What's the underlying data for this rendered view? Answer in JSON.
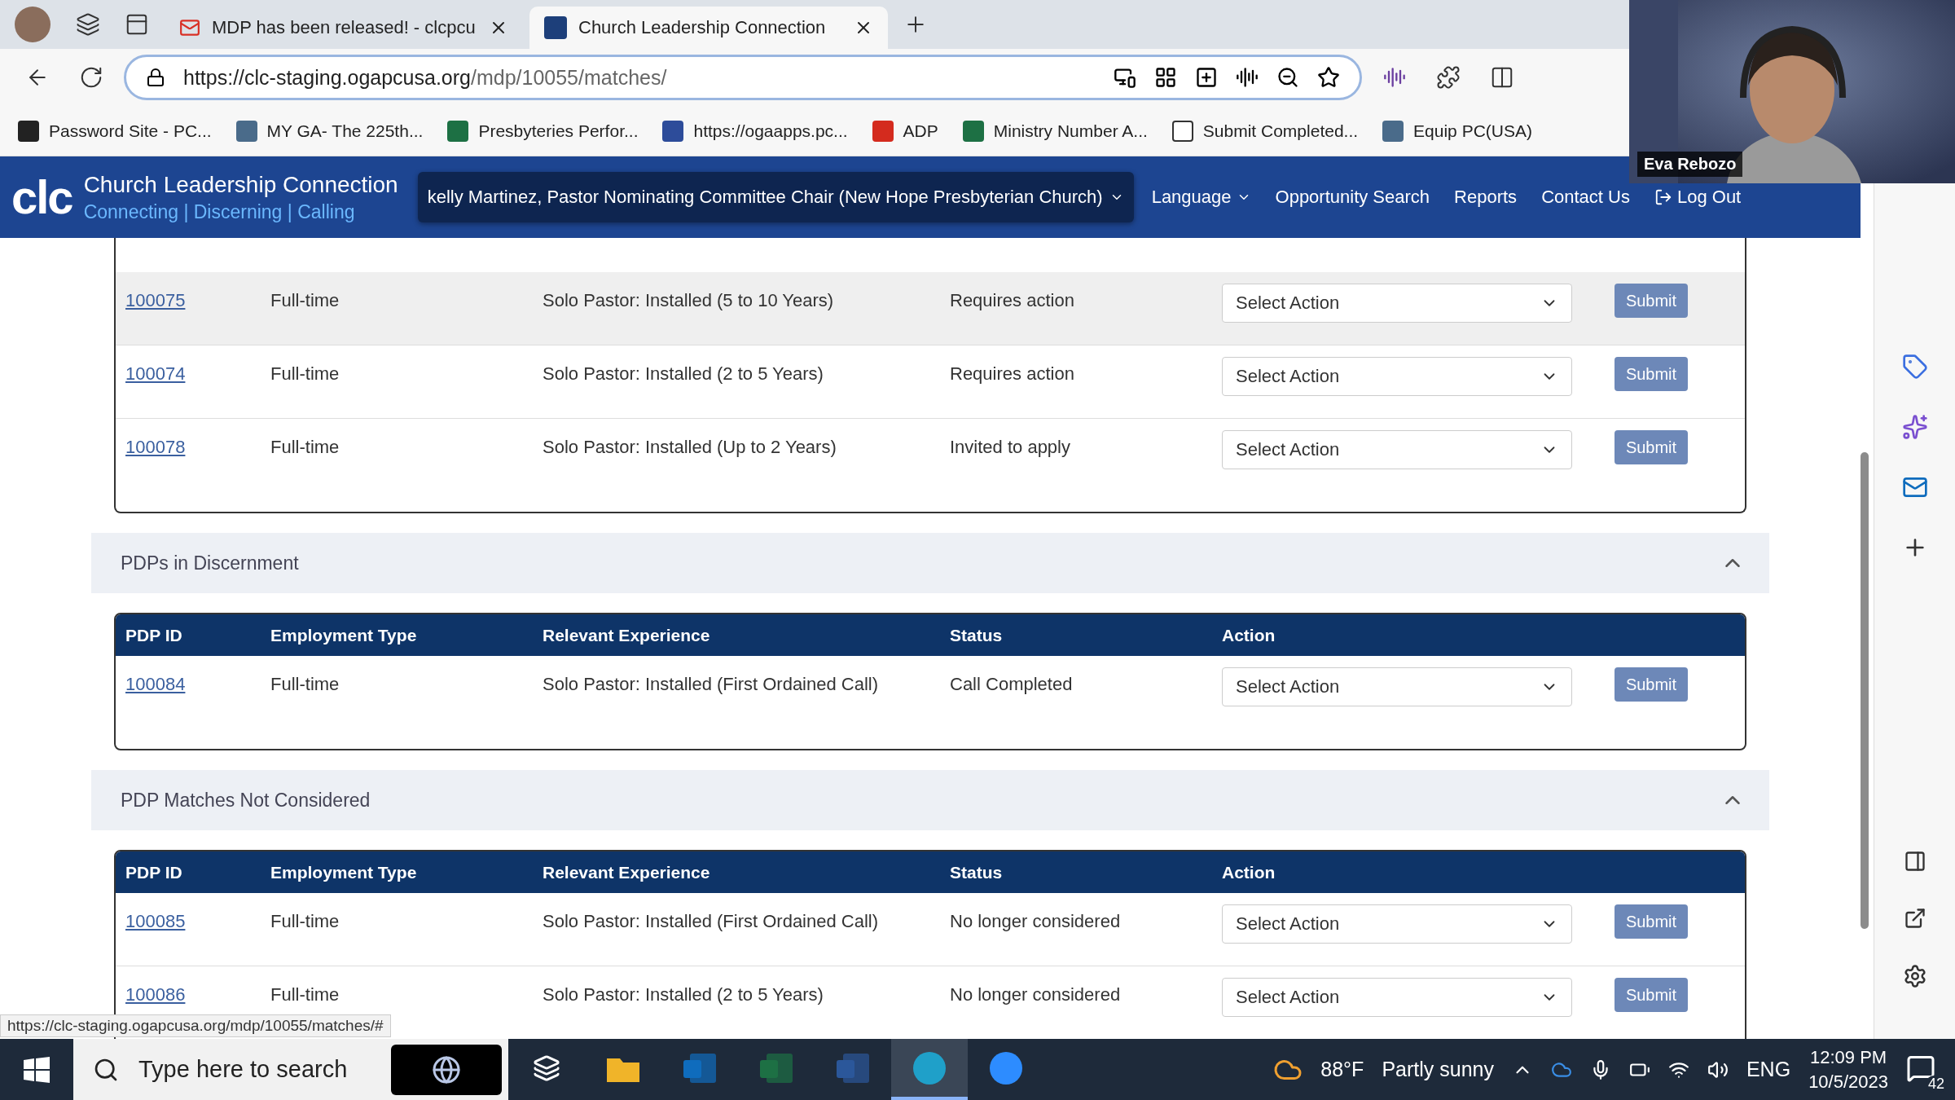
{
  "browser": {
    "tabs": [
      {
        "kind": "mail",
        "title": "MDP has been released! - clcpcu",
        "selected": false
      },
      {
        "kind": "site",
        "title": "Church Leadership Connection",
        "selected": true
      }
    ],
    "url_host": "https://clc-staging.ogapcusa.org",
    "url_path": "/mdp/10055/matches/",
    "bookmarks": [
      {
        "kind": "key",
        "label": "Password Site - PC..."
      },
      {
        "kind": "globe",
        "label": "MY GA- The 225th..."
      },
      {
        "kind": "sheet",
        "label": "Presbyteries Perfor..."
      },
      {
        "kind": "cross",
        "label": "https://ogaapps.pc..."
      },
      {
        "kind": "red",
        "label": "ADP"
      },
      {
        "kind": "sheet",
        "label": "Ministry Number A..."
      },
      {
        "kind": "page",
        "label": "Submit Completed..."
      },
      {
        "kind": "globe",
        "label": "Equip PC(USA)"
      }
    ]
  },
  "navbar": {
    "logo": "clc",
    "brand": "Church Leadership Connection",
    "tagline": "Connecting | Discerning | Calling",
    "user_menu": "kelly Martinez, Pastor Nominating Committee Chair (New Hope Presbyterian Church)",
    "links": [
      {
        "label": "Language",
        "kind": "dropdown"
      },
      {
        "label": "Opportunity Search",
        "kind": "link"
      },
      {
        "label": "Reports",
        "kind": "link"
      },
      {
        "label": "Contact Us",
        "kind": "link"
      },
      {
        "label": "Log Out",
        "kind": "logout"
      }
    ]
  },
  "sections": [
    {
      "rows": [
        {
          "id": "100075",
          "employment": "Full-time",
          "experience": "Solo Pastor: Installed (5 to 10 Years)",
          "status": "Requires action",
          "action": "Select Action",
          "button": "Submit",
          "highlighted": true
        },
        {
          "id": "100074",
          "employment": "Full-time",
          "experience": "Solo Pastor: Installed (2 to 5 Years)",
          "status": "Requires action",
          "action": "Select Action",
          "button": "Submit",
          "highlighted": false
        },
        {
          "id": "100078",
          "employment": "Full-time",
          "experience": "Solo Pastor: Installed (Up to 2 Years)",
          "status": "Invited to apply",
          "action": "Select Action",
          "button": "Submit",
          "highlighted": false
        }
      ]
    },
    {
      "title": "PDPs in Discernment",
      "expanded": true,
      "columns": [
        "PDP ID",
        "Employment Type",
        "Relevant Experience",
        "Status",
        "Action"
      ],
      "rows": [
        {
          "id": "100084",
          "employment": "Full-time",
          "experience": "Solo Pastor: Installed (First Ordained Call)",
          "status": "Call Completed",
          "action": "Select Action",
          "button": "Submit",
          "highlighted": false
        }
      ]
    },
    {
      "title": "PDP Matches Not Considered",
      "expanded": true,
      "columns": [
        "PDP ID",
        "Employment Type",
        "Relevant Experience",
        "Status",
        "Action"
      ],
      "rows": [
        {
          "id": "100085",
          "employment": "Full-time",
          "experience": "Solo Pastor: Installed (First Ordained Call)",
          "status": "No longer considered",
          "action": "Select Action",
          "button": "Submit",
          "highlighted": false
        },
        {
          "id": "100086",
          "employment": "Full-time",
          "experience": "Solo Pastor: Installed (2 to 5 Years)",
          "status": "No longer considered",
          "action": "Select Action",
          "button": "Submit",
          "highlighted": false
        }
      ]
    }
  ],
  "link_preview": "https://clc-staging.ogapcusa.org/mdp/10055/matches/#",
  "video": {
    "name": "Eva Rebozo"
  },
  "taskbar": {
    "search_placeholder": "Type here to search",
    "apps": [
      {
        "kind": "taskview",
        "active": false
      },
      {
        "kind": "folder",
        "active": false
      },
      {
        "kind": "mail",
        "active": false
      },
      {
        "kind": "sheet",
        "active": false
      },
      {
        "kind": "doc",
        "active": false
      },
      {
        "kind": "browser",
        "active": true
      },
      {
        "kind": "video",
        "active": false
      }
    ],
    "temperature": "88°F",
    "weather": "Partly sunny",
    "language": "ENG",
    "time": "12:09 PM",
    "date": "10/5/2023",
    "notifications": "42"
  }
}
